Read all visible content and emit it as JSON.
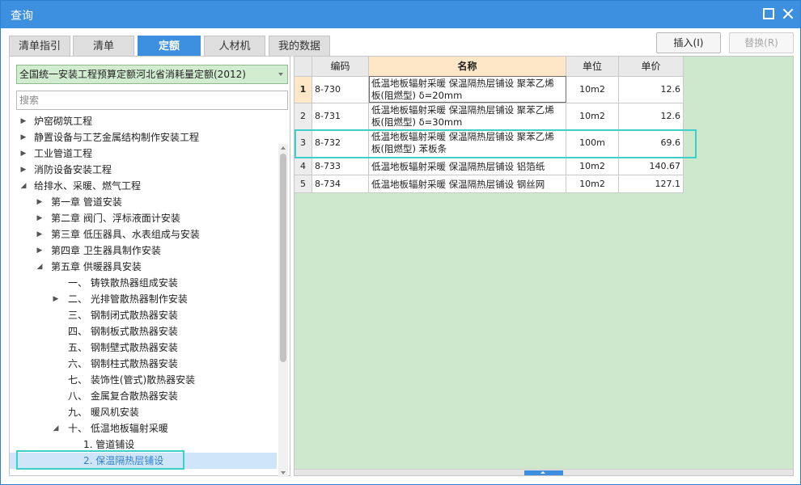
{
  "window": {
    "title": "查询"
  },
  "tabs": [
    {
      "label": "清单指引"
    },
    {
      "label": "清单"
    },
    {
      "label": "定额",
      "active": true
    },
    {
      "label": "人材机"
    },
    {
      "label": "我的数据"
    }
  ],
  "actions": {
    "insert_label": "插入(I)",
    "replace_label": "替换(R)"
  },
  "library_select": {
    "value": "全国统一安装工程预算定额河北省消耗量定额(2012)"
  },
  "search": {
    "placeholder": "搜索"
  },
  "tree": [
    {
      "label": "炉窑砌筑工程",
      "expander": "collapsed"
    },
    {
      "label": "静置设备与工艺金属结构制作安装工程",
      "expander": "collapsed"
    },
    {
      "label": "工业管道工程",
      "expander": "collapsed"
    },
    {
      "label": "消防设备安装工程",
      "expander": "collapsed"
    },
    {
      "label": "给排水、采暖、燃气工程",
      "expander": "expanded"
    },
    {
      "label": "第一章 管道安装",
      "expander": "collapsed"
    },
    {
      "label": "第二章 阀门、浮标液面计安装",
      "expander": "collapsed"
    },
    {
      "label": "第三章 低压器具、水表组成与安装",
      "expander": "collapsed"
    },
    {
      "label": "第四章 卫生器具制作安装",
      "expander": "collapsed"
    },
    {
      "label": "第五章 供暖器具安装",
      "expander": "expanded"
    },
    {
      "label": "一、 铸铁散热器组成安装",
      "expander": "none"
    },
    {
      "label": "二、 光排管散热器制作安装",
      "expander": "collapsed"
    },
    {
      "label": "三、 钢制闭式散热器安装",
      "expander": "none"
    },
    {
      "label": "四、 钢制板式散热器安装",
      "expander": "none"
    },
    {
      "label": "五、 钢制壁式散热器安装",
      "expander": "none"
    },
    {
      "label": "六、 钢制柱式散热器安装",
      "expander": "none"
    },
    {
      "label": "七、 装饰性(管式)散热器安装",
      "expander": "none"
    },
    {
      "label": "八、 金属复合散热器安装",
      "expander": "none"
    },
    {
      "label": "九、 暖风机安装",
      "expander": "none"
    },
    {
      "label": "十、 低温地板辐射采暖",
      "expander": "expanded"
    },
    {
      "label": "1. 管道铺设",
      "expander": "none"
    },
    {
      "label": "2. 保温隔热层铺设",
      "expander": "none",
      "selected": true
    }
  ],
  "grid": {
    "columns": {
      "code": "编码",
      "name": "名称",
      "unit": "单位",
      "price": "单价"
    },
    "rows": [
      {
        "index": "1",
        "code": "8-730",
        "name": "低温地板辐射采暖 保温隔热层铺设 聚苯乙烯板(阻燃型) δ=20mm",
        "unit": "10m2",
        "price": "12.6"
      },
      {
        "index": "2",
        "code": "8-731",
        "name": "低温地板辐射采暖 保温隔热层铺设 聚苯乙烯板(阻燃型) δ=30mm",
        "unit": "10m2",
        "price": "12.6"
      },
      {
        "index": "3",
        "code": "8-732",
        "name": "低温地板辐射采暖 保温隔热层铺设 聚苯乙烯板(阻燃型) 苯板条",
        "unit": "100m",
        "price": "69.6"
      },
      {
        "index": "4",
        "code": "8-733",
        "name": "低温地板辐射采暖 保温隔热层铺设 铝箔纸",
        "unit": "10m2",
        "price": "140.67"
      },
      {
        "index": "5",
        "code": "8-734",
        "name": "低温地板辐射采暖 保温隔热层铺设 钢丝网",
        "unit": "10m2",
        "price": "127.1"
      }
    ]
  },
  "colors": {
    "titlebar": "#3d8fe0",
    "active_tab": "#3d8fe0",
    "grid_background": "#cde8cd",
    "highlight": "#3dcfc8",
    "selected_tree_text": "#2f7fd0"
  }
}
